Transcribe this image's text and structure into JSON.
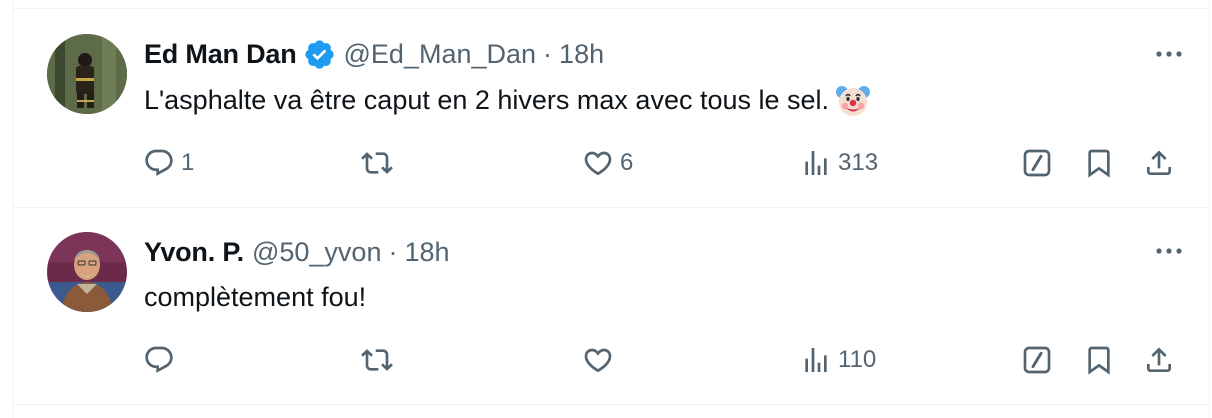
{
  "tweets": [
    {
      "name": "Ed Man Dan",
      "verified": true,
      "handle": "@Ed_Man_Dan",
      "separator": "·",
      "time": "18h",
      "text": "L'asphalte va être caput en 2 hivers max avec tous le sel.",
      "emoji": "clown-face",
      "replies": "1",
      "retweets": "",
      "likes": "6",
      "views": "313"
    },
    {
      "name": "Yvon. P.",
      "verified": false,
      "handle": "@50_yvon",
      "separator": "·",
      "time": "18h",
      "text": "complètement fou!",
      "replies": "",
      "retweets": "",
      "likes": "",
      "views": "110"
    }
  ],
  "colors": {
    "text": "#0f1419",
    "secondary": "#536471",
    "verified": "#1d9bf0",
    "divider": "#eff3f4"
  },
  "icons": [
    "reply-icon",
    "retweet-icon",
    "like-icon",
    "views-icon",
    "grok-icon",
    "bookmark-icon",
    "share-icon",
    "more-icon",
    "verified-badge-icon"
  ]
}
